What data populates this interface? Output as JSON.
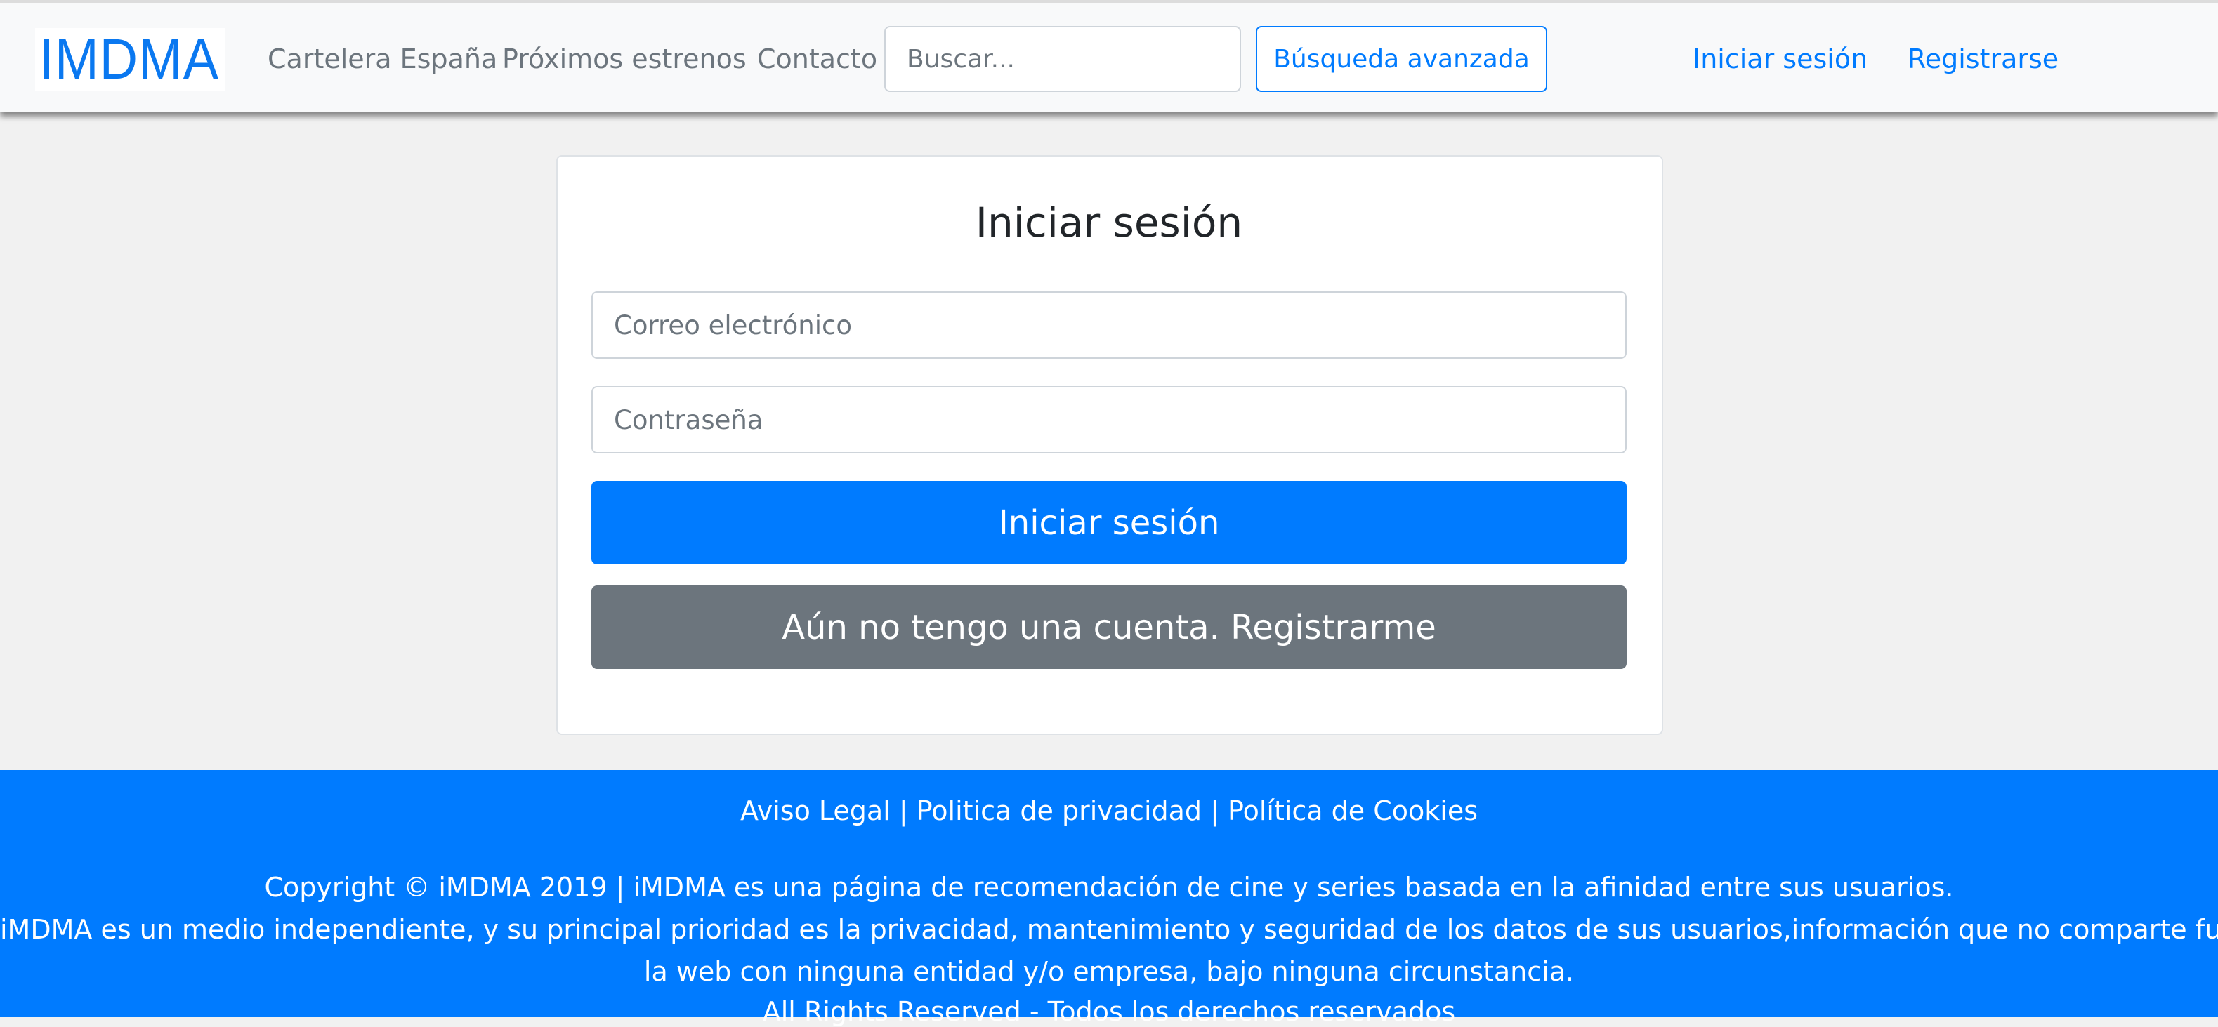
{
  "navbar": {
    "logo": "IMDMA",
    "links": [
      "Cartelera España",
      "Próximos estrenos",
      "Contacto"
    ],
    "search_placeholder": "Buscar...",
    "advanced_search_label": "Búsqueda avanzada",
    "login_label": "Iniciar sesión",
    "register_label": "Registrarse"
  },
  "login_card": {
    "title": "Iniciar sesión",
    "email_placeholder": "Correo electrónico",
    "password_placeholder": "Contraseña",
    "submit_label": "Iniciar sesión",
    "register_label": "Aún no tengo una cuenta. Registrarme"
  },
  "footer": {
    "legal_links": [
      "Aviso Legal",
      "Politica de privacidad",
      "Política de Cookies"
    ],
    "separator": "|",
    "lines": [
      "Copyright © iMDMA 2019 | iMDMA es una página de recomendación de cine y series basada en la afinidad entre sus usuarios.",
      "iMDMA es un medio independiente, y su principal prioridad es la privacidad, mantenimiento y seguridad de los datos de sus usuarios,información que no comparte fuera de",
      "la web con ninguna entidad y/o empresa, bajo ninguna circunstancia.",
      "All Rights Reserved - Todos los derechos reservados"
    ]
  },
  "colors": {
    "primary": "#007bff",
    "secondary": "#6c757d",
    "background": "#f1f1f1"
  }
}
